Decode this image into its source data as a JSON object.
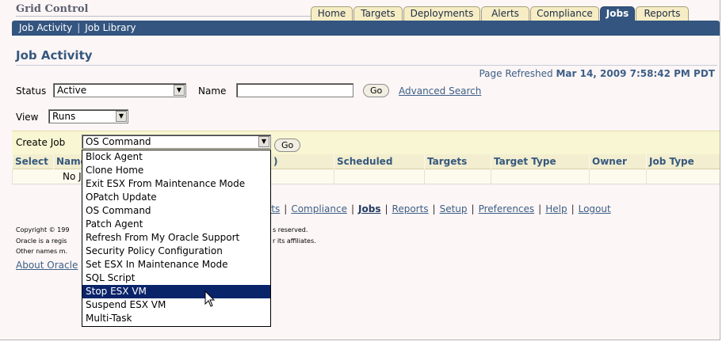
{
  "header": {
    "brand": "Grid Control",
    "tabs": [
      "Home",
      "Targets",
      "Deployments",
      "Alerts",
      "Compliance",
      "Jobs",
      "Reports"
    ],
    "active_tab": "Jobs",
    "subnav": [
      "Job Activity",
      "Job Library"
    ]
  },
  "page": {
    "title": "Job Activity",
    "refreshed_label": "Page Refreshed",
    "refreshed_value": "Mar 14, 2009 7:58:42 PM PDT"
  },
  "filters": {
    "status_label": "Status",
    "status_value": "Active",
    "name_label": "Name",
    "name_value": "",
    "go_label": "Go",
    "advanced_search": "Advanced Search",
    "view_label": "View",
    "view_value": "Runs"
  },
  "create_job": {
    "label": "Create Job",
    "value": "OS Command",
    "go_label": "Go"
  },
  "table": {
    "headers": [
      "Select",
      "Name",
      ")",
      "Scheduled",
      "Targets",
      "Target Type",
      "Owner",
      "Job Type"
    ],
    "empty_text": "No Jo"
  },
  "footer": {
    "links": [
      "erts",
      "Compliance",
      "Jobs",
      "Reports",
      "Setup",
      "Preferences",
      "Help",
      "Logout"
    ],
    "copyright_lines": [
      "Copyright © 199",
      "Oracle is a regis",
      "Other names m."
    ],
    "copyright_right": [
      "s reserved.",
      "r its affiliates."
    ],
    "about": "About Oracle"
  },
  "dropdown": {
    "items": [
      "Block Agent",
      "Clone Home",
      "Exit ESX From Maintenance Mode",
      "OPatch Update",
      "OS Command",
      "Patch Agent",
      "Refresh From My Oracle Support",
      "Security Policy Configuration",
      "Set ESX In Maintenance Mode",
      "SQL Script",
      "Stop ESX VM",
      "Suspend ESX VM",
      "Multi-Task"
    ],
    "highlighted": "Stop ESX VM"
  },
  "icons": {
    "dropdown_arrow": "chevron-down-icon",
    "pointer": "mouse-pointer-icon"
  },
  "colors": {
    "brand_blue": "#33557f",
    "link_blue": "#3b5f87",
    "tab_tan": "#f6edc4",
    "selection": "#0a246a"
  }
}
